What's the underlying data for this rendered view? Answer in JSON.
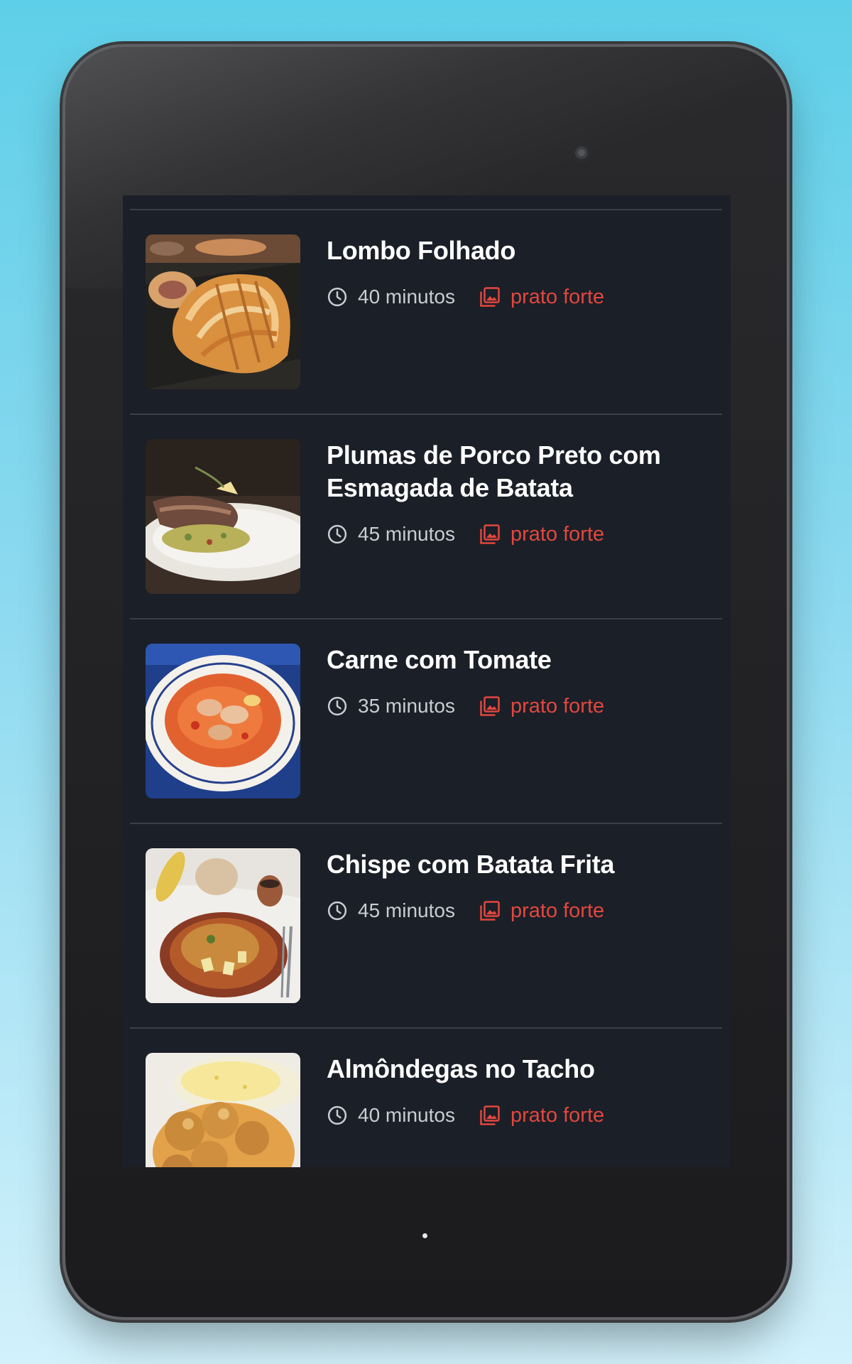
{
  "colors": {
    "background": "#1b1f27",
    "title": "#ffffff",
    "meta_text": "#c9ccd2",
    "accent": "#e2473f",
    "divider": "#3a3f48"
  },
  "icons": {
    "time": "clock-icon",
    "category": "image-gallery-icon"
  },
  "recipes": [
    {
      "title": "Lombo Folhado",
      "time": "40 minutos",
      "category": "prato forte"
    },
    {
      "title": "Plumas de Porco Preto com Esmagada de Batata",
      "time": "45 minutos",
      "category": "prato forte"
    },
    {
      "title": "Carne com Tomate",
      "time": "35 minutos",
      "category": "prato forte"
    },
    {
      "title": "Chispe com Batata Frita",
      "time": "45 minutos",
      "category": "prato forte"
    },
    {
      "title": "Almôndegas no Tacho",
      "time": "40 minutos",
      "category": "prato forte"
    }
  ]
}
